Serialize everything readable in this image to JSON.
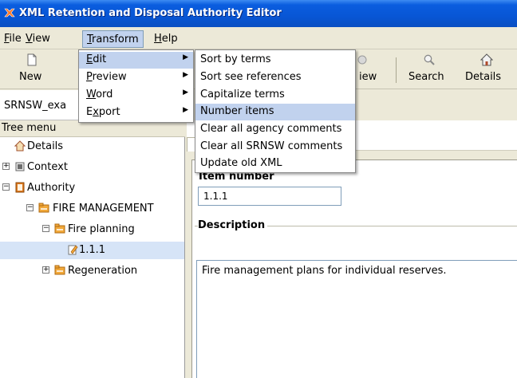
{
  "window": {
    "title": "XML Retention and Disposal Authority Editor"
  },
  "menubar": {
    "file": {
      "pre": "",
      "key": "F",
      "post": "ile"
    },
    "view": {
      "pre": "",
      "key": "V",
      "post": "iew"
    },
    "transform": {
      "pre": "",
      "key": "T",
      "post": "ransform"
    },
    "help": {
      "pre": "",
      "key": "H",
      "post": "elp"
    }
  },
  "toolbar": {
    "new_label": "New",
    "view_partial": "iew",
    "search_label": "Search",
    "details_label": "Details"
  },
  "transform_menu": {
    "items": [
      {
        "pre": "",
        "key": "E",
        "post": "dit"
      },
      {
        "pre": "",
        "key": "P",
        "post": "review"
      },
      {
        "pre": "",
        "key": "W",
        "post": "ord"
      },
      {
        "pre": "E",
        "key": "x",
        "post": "port"
      }
    ]
  },
  "edit_submenu": {
    "items": [
      "Sort by terms",
      "Sort see references",
      "Capitalize terms",
      "Number items",
      "Clear all agency comments",
      "Clear all SRNSW comments",
      "Update old XML"
    ]
  },
  "left": {
    "doc_tab_label": "SRNSW_exa",
    "tree_header": "Tree menu"
  },
  "tree": {
    "details": "Details",
    "context": "Context",
    "authority": "Authority",
    "fire_management": "FIRE MANAGEMENT",
    "fire_planning": "Fire planning",
    "item_111": "1.1.1",
    "regeneration": "Regeneration"
  },
  "form": {
    "item_number_label": "Item number",
    "item_number_value": "1.1.1",
    "description_label": "Description",
    "description_value": "Fire management plans for individual reserves."
  },
  "colors": {
    "title_bar": "#0a5ddf",
    "menu_highlight": "#c1d2ee",
    "tree_selection": "#d6e4f7"
  }
}
